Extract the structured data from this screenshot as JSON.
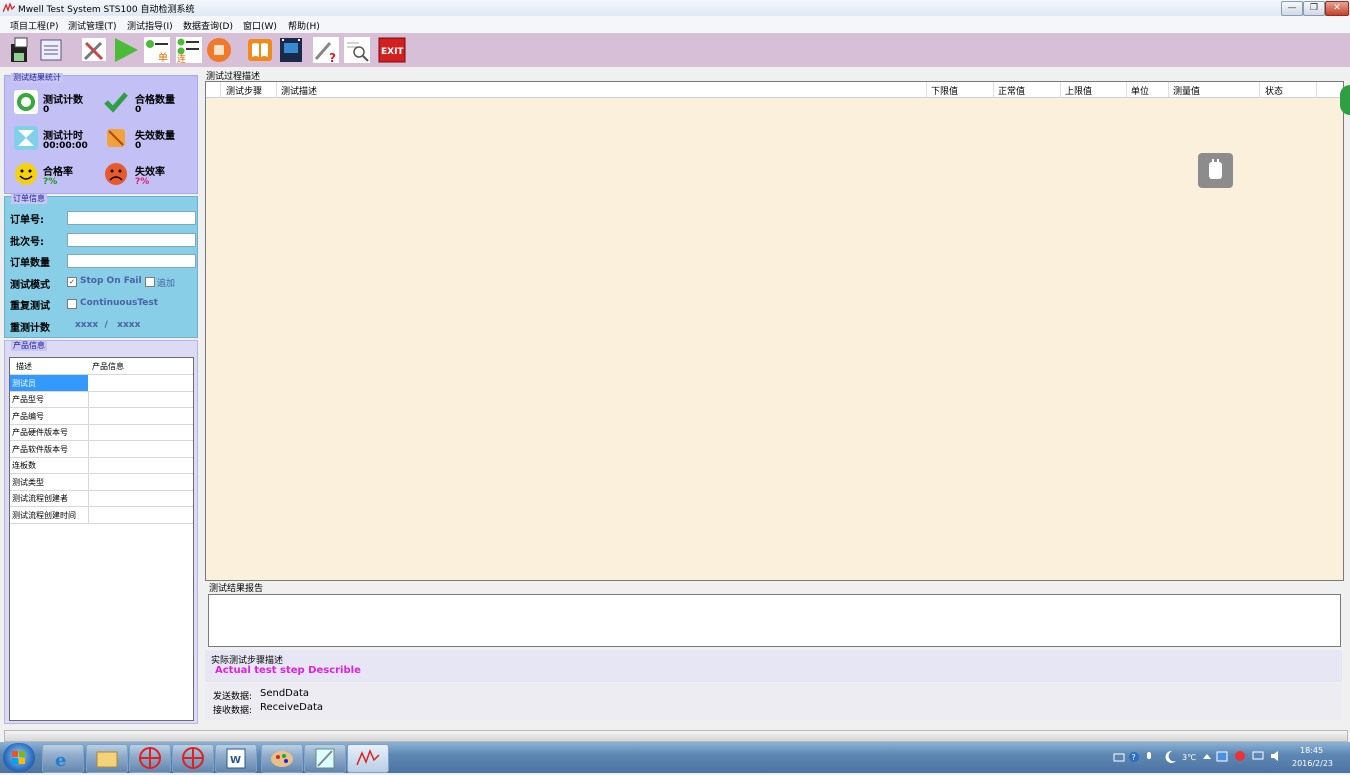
{
  "window": {
    "title": "Mwell Test System STS100 自动检测系统",
    "minimize_glyph": "—",
    "restore_glyph": "❐",
    "close_glyph": "✕"
  },
  "menu": [
    "项目工程(P)",
    "测试管理(T)",
    "测试指导(I)",
    "数据查询(D)",
    "窗口(W)",
    "帮助(H)"
  ],
  "toolbar": {
    "exit_label": "EXIT",
    "icons": [
      "save-icon",
      "manage-icon",
      "tools-icon",
      "run-icon",
      "single-step-icon",
      "continuous-icon",
      "stop-icon",
      "book-icon",
      "film-icon",
      "help-icon",
      "search-icon",
      "exit-icon"
    ],
    "single_char": "单",
    "continuous_char": "连"
  },
  "stats": {
    "group_title": "测试结果统计",
    "test_count_label": "测试计数",
    "test_count_value": "0",
    "pass_count_label": "合格数量",
    "pass_count_value": "0",
    "test_time_label": "测试计时",
    "test_time_value": "00:00:00",
    "fail_count_label": "失效数量",
    "fail_count_value": "0",
    "pass_rate_label": "合格率",
    "pass_rate_value": "?%",
    "fail_rate_label": "失效率",
    "fail_rate_value": "?%",
    "pass_rate_color": "#1a9a1a",
    "fail_rate_color": "#e0206a"
  },
  "order": {
    "group_title": "订单信息",
    "order_no_label": "订单号:",
    "batch_no_label": "批次号:",
    "order_qty_label": "订单数量",
    "test_mode_label": "测试模式",
    "stop_on_fail_label": "Stop On Fail",
    "stop_on_fail_checked": true,
    "append_label": "追加",
    "repeat_test_label": "重复测试",
    "continuous_test_label": "ContinuousTest",
    "retest_count_label": "重测计数",
    "retest_count_value": "xxxx  /   xxxx"
  },
  "product": {
    "group_title": "产品信息",
    "col_desc": "描述",
    "col_info": "产品信息",
    "rows": [
      "测试员",
      "产品型号",
      "产品编号",
      "产品硬件版本号",
      "产品软件版本号",
      "连板数",
      "测试类型",
      "测试流程创建者",
      "测试流程创建时间"
    ]
  },
  "main": {
    "process_title": "测试过程描述",
    "columns": [
      "测试步骤",
      "测试描述",
      "下限值",
      "正常值",
      "上限值",
      "单位",
      "测量值",
      "状态"
    ],
    "report_title": "测试结果报告",
    "actual_title": "实际测试步骤描述",
    "actual_desc": "Actual test step Describle",
    "send_label": "发送数据:",
    "send_value": "SendData",
    "recv_label": "接收数据:",
    "recv_value": "ReceiveData"
  },
  "taskbar": {
    "apps": [
      "ie-icon",
      "folder-icon",
      "app-red-icon",
      "app-red-icon",
      "word-icon",
      "paint-icon",
      "tool-icon",
      "mwell-icon"
    ],
    "weather": "3℃",
    "time": "18:45",
    "date": "2016/2/23"
  }
}
